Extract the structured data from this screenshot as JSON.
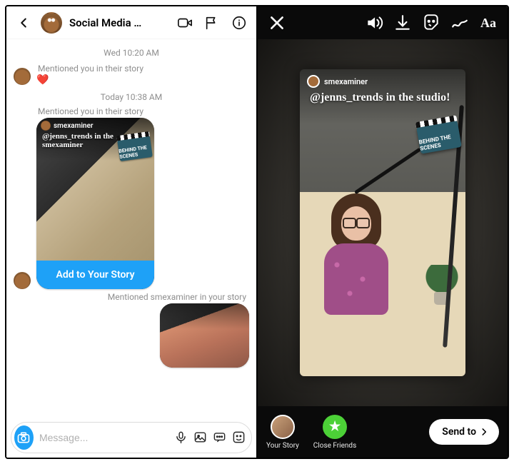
{
  "left": {
    "header": {
      "title": "Social Media …"
    },
    "thread": {
      "ts1": "Wed 10:20 AM",
      "mention1": "Mentioned you in their story",
      "heart": "❤️",
      "ts2": "Today 10:38 AM",
      "mention2": "Mentioned you in their story",
      "story_overlay_text": "@jenns_trends in the smexaminer",
      "story_user_chip": "smexaminer",
      "badge_text": "BEHIND THE SCENES",
      "add_button": "Add to Your Story",
      "mention3": "Mentioned smexaminer in your story"
    },
    "composer": {
      "placeholder": "Message..."
    }
  },
  "right": {
    "toolbar": {
      "text_label": "Aa"
    },
    "canvas": {
      "user_chip": "smexaminer",
      "caption": "@jenns_trends in the studio!",
      "badge_text": "BEHIND THE SCENES"
    },
    "bottom": {
      "your_story": "Your Story",
      "close_friends": "Close Friends",
      "close_friends_glyph": "★",
      "send_to": "Send to"
    }
  },
  "colors": {
    "accent_blue": "#1ea1f7",
    "arrow_red": "#f43a1f",
    "close_friends_green": "#4cd137"
  }
}
